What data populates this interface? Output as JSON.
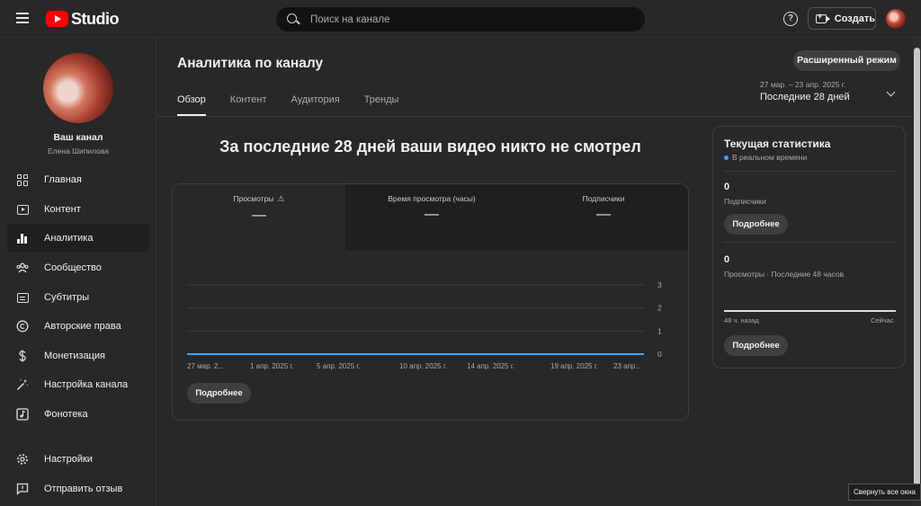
{
  "topbar": {
    "logo_text": "Studio",
    "search_placeholder": "Поиск на канале",
    "help_symbol": "?",
    "create_label": "Создать"
  },
  "sidebar": {
    "channel_title": "Ваш канал",
    "channel_name": "Елена Шипилова",
    "items": [
      {
        "label": "Главная",
        "icon": "dashboard-icon"
      },
      {
        "label": "Контент",
        "icon": "content-icon"
      },
      {
        "label": "Аналитика",
        "icon": "analytics-icon",
        "active": true
      },
      {
        "label": "Сообщество",
        "icon": "community-icon"
      },
      {
        "label": "Субтитры",
        "icon": "subtitles-icon"
      },
      {
        "label": "Авторские права",
        "icon": "copyright-icon"
      },
      {
        "label": "Монетизация",
        "icon": "dollar-icon"
      },
      {
        "label": "Настройка канала",
        "icon": "magic-wand-icon"
      },
      {
        "label": "Фонотека",
        "icon": "audio-library-icon"
      }
    ],
    "bottom_items": [
      {
        "label": "Настройки",
        "icon": "gear-icon"
      },
      {
        "label": "Отправить отзыв",
        "icon": "feedback-icon"
      }
    ]
  },
  "main": {
    "title": "Аналитика по каналу",
    "advanced_mode": "Расширенный режим",
    "tabs": [
      "Обзор",
      "Контент",
      "Аудитория",
      "Тренды"
    ],
    "date_range": {
      "dates": "27 мар. – 23 апр. 2025 г.",
      "period": "Последние 28 дней"
    },
    "headline": "За последние 28 дней ваши видео никто не смотрел",
    "metrics": [
      {
        "label": "Просмотры",
        "value": "—",
        "warning_symbol": "⚠"
      },
      {
        "label": "Время просмотра (часы)",
        "value": "—"
      },
      {
        "label": "Подписчики",
        "value": "—"
      }
    ],
    "more_label": "Подробнее"
  },
  "chart_data": {
    "type": "line",
    "x": [
      "27 мар. 2...",
      "1 апр. 2025 г.",
      "5 апр. 2025 г.",
      "10 апр. 2025 г.",
      "14 апр. 2025 г.",
      "19 апр. 2025 г.",
      "23 апр..."
    ],
    "series": [
      {
        "values": [
          0,
          0,
          0,
          0,
          0,
          0,
          0
        ]
      }
    ],
    "ylim": [
      0,
      3
    ],
    "yticks": [
      "0",
      "1",
      "2",
      "3"
    ],
    "grid": true,
    "line_color": "#3ea6ff"
  },
  "stats": {
    "title": "Текущая статистика",
    "live": "В реальном времени",
    "subscribers_value": "0",
    "subscribers_label": "Подписчики",
    "views_value": "0",
    "views_label": "Просмотры · Последние 48 часов",
    "time_start": "48 ч. назад",
    "time_end": "Сейчас",
    "more_label": "Подробнее"
  },
  "tooltip": "Свернуть все окна"
}
